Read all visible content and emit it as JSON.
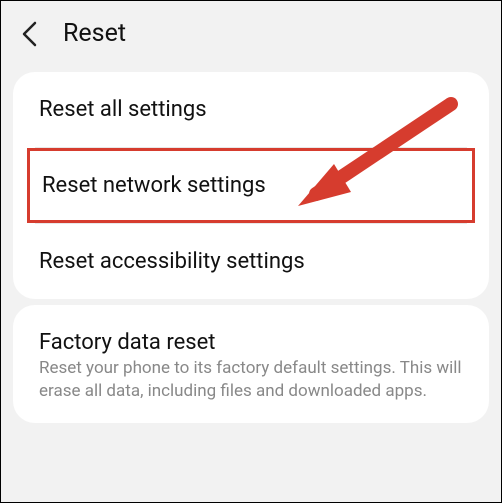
{
  "header": {
    "title": "Reset"
  },
  "group1": {
    "items": [
      {
        "label": "Reset all settings"
      },
      {
        "label": "Reset network settings"
      },
      {
        "label": "Reset accessibility settings"
      }
    ]
  },
  "group2": {
    "title": "Factory data reset",
    "description": "Reset your phone to its factory default settings. This will erase all data, including files and downloaded apps."
  },
  "annotation": {
    "highlight_color": "#d63c2e",
    "arrow_color": "#d63c2e"
  }
}
